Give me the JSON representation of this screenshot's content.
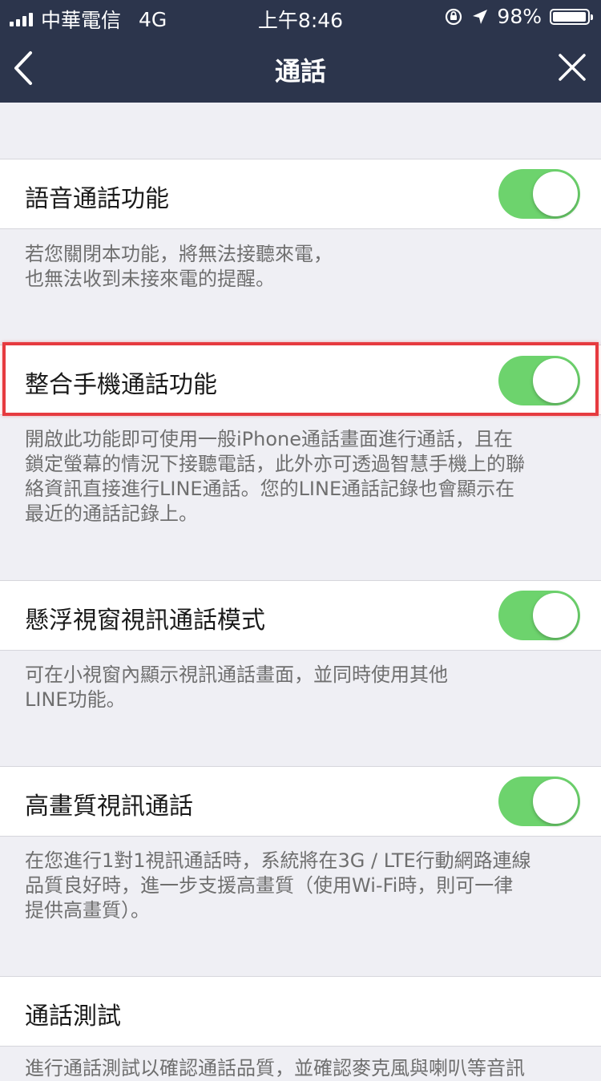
{
  "status_bar": {
    "carrier": "中華電信",
    "network": "4G",
    "time": "上午8:46",
    "battery_text": "98%",
    "battery_level": 0.98
  },
  "nav": {
    "title": "通話",
    "back_icon": "chevron-left-icon",
    "close_icon": "close-icon"
  },
  "settings": [
    {
      "label": "語音通話功能",
      "enabled": true,
      "description": "若您關閉本功能，將無法接聽來電，\n也無法收到未接來電的提醒。"
    },
    {
      "label": "整合手機通話功能",
      "enabled": true,
      "description": "開啟此功能即可使用一般iPhone通話畫面進行通話，且在\n鎖定螢幕的情況下接聽電話，此外亦可透過智慧手機上的聯\n絡資訊直接進行LINE通話。您的LINE通話記錄也會顯示在\n最近的通話記錄上。"
    },
    {
      "label": "懸浮視窗視訊通話模式",
      "enabled": true,
      "description": "可在小視窗內顯示視訊通話畫面，並同時使用其他\nLINE功能。"
    },
    {
      "label": "高畫質視訊通話",
      "enabled": true,
      "description": "在您進行1對1視訊通話時，系統將在3G / LTE行動網路連線\n品質良好時，進一步支援高畫質（使用Wi-Fi時，則可一律\n提供高畫質）。"
    },
    {
      "label": "通話測試",
      "description": "進行通話測試以確認通話品質，並確認麥克風與喇叭等音訊"
    }
  ],
  "colors": {
    "nav_bg": "#2c354c",
    "toggle_on": "#6dd36d",
    "highlight": "#e63a3f",
    "page_bg": "#efeff4"
  }
}
